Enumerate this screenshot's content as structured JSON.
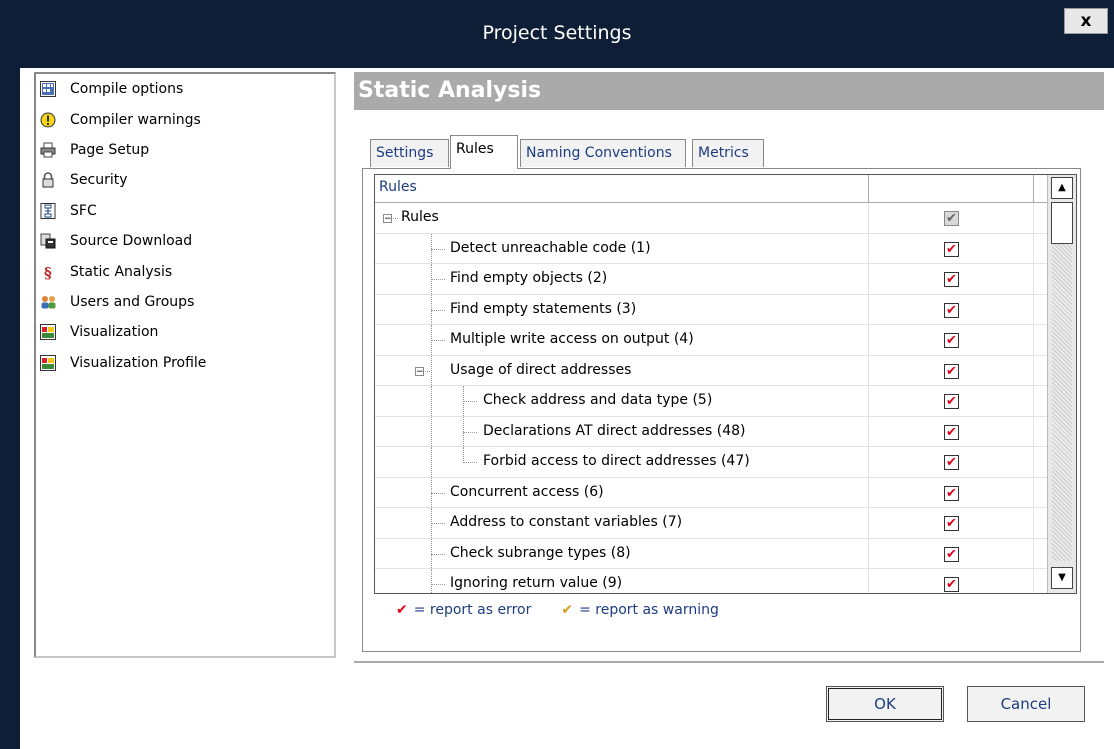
{
  "window": {
    "title": "Project Settings",
    "close_label": "x"
  },
  "nav": {
    "items": [
      {
        "label": "Compile options",
        "icon": "compile-options-icon"
      },
      {
        "label": "Compiler warnings",
        "icon": "warning-icon"
      },
      {
        "label": "Page Setup",
        "icon": "printer-icon"
      },
      {
        "label": "Security",
        "icon": "lock-icon"
      },
      {
        "label": "SFC",
        "icon": "sfc-icon"
      },
      {
        "label": "Source Download",
        "icon": "source-download-icon"
      },
      {
        "label": "Static Analysis",
        "icon": "section-icon"
      },
      {
        "label": "Users and Groups",
        "icon": "users-icon"
      },
      {
        "label": "Visualization",
        "icon": "visualization-icon"
      },
      {
        "label": "Visualization Profile",
        "icon": "visualization-icon"
      }
    ]
  },
  "panel": {
    "title": "Static Analysis"
  },
  "tabs": [
    {
      "label": "Settings",
      "active": false
    },
    {
      "label": "Rules",
      "active": true
    },
    {
      "label": "Naming Conventions",
      "active": false
    },
    {
      "label": "Metrics",
      "active": false
    }
  ],
  "grid": {
    "header": "Rules",
    "rows": [
      {
        "label": "Rules",
        "level": 0,
        "expander": "-",
        "checked": "gray"
      },
      {
        "label": "Detect unreachable code (1)",
        "level": 1,
        "checked": "error"
      },
      {
        "label": "Find empty objects (2)",
        "level": 1,
        "checked": "error"
      },
      {
        "label": "Find empty statements (3)",
        "level": 1,
        "checked": "error"
      },
      {
        "label": "Multiple write access on output (4)",
        "level": 1,
        "checked": "error"
      },
      {
        "label": "Usage of direct addresses",
        "level": 1,
        "expander": "-",
        "checked": "error"
      },
      {
        "label": "Check address and data type (5)",
        "level": 2,
        "checked": "error"
      },
      {
        "label": "Declarations AT direct addresses (48)",
        "level": 2,
        "checked": "error"
      },
      {
        "label": "Forbid access to direct addresses (47)",
        "level": 2,
        "checked": "error"
      },
      {
        "label": "Concurrent access (6)",
        "level": 1,
        "checked": "error"
      },
      {
        "label": "Address to constant variables (7)",
        "level": 1,
        "checked": "error"
      },
      {
        "label": "Check subrange types (8)",
        "level": 1,
        "checked": "error"
      },
      {
        "label": "Ignoring return value (9)",
        "level": 1,
        "checked": "error"
      }
    ]
  },
  "legend": {
    "error_label": "= report as error",
    "warning_label": "= report as warning",
    "error_color": "#e0001b",
    "warning_color": "#d4a017"
  },
  "buttons": {
    "ok_label": "OK",
    "cancel_label": "Cancel"
  }
}
